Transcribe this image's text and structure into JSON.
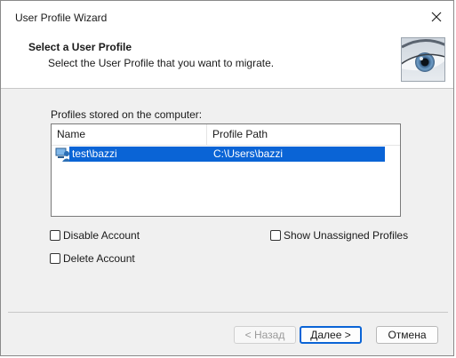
{
  "window": {
    "title": "User Profile Wizard"
  },
  "header": {
    "title": "Select a User Profile",
    "subtitle": "Select the User Profile that you want to migrate."
  },
  "profiles": {
    "label": "Profiles stored on the computer:",
    "columns": [
      "Name",
      "Profile Path"
    ],
    "rows": [
      {
        "name": "test\\bazzi",
        "path": "C:\\Users\\bazzi",
        "selected": true
      }
    ]
  },
  "options": {
    "disable_account": "Disable Account",
    "delete_account": "Delete Account",
    "show_unassigned": "Show Unassigned Profiles"
  },
  "buttons": {
    "back": "< Назад",
    "next": "Далее >",
    "cancel": "Отмена"
  },
  "colors": {
    "selection": "#0a64d6",
    "accent": "#0a64d6"
  }
}
